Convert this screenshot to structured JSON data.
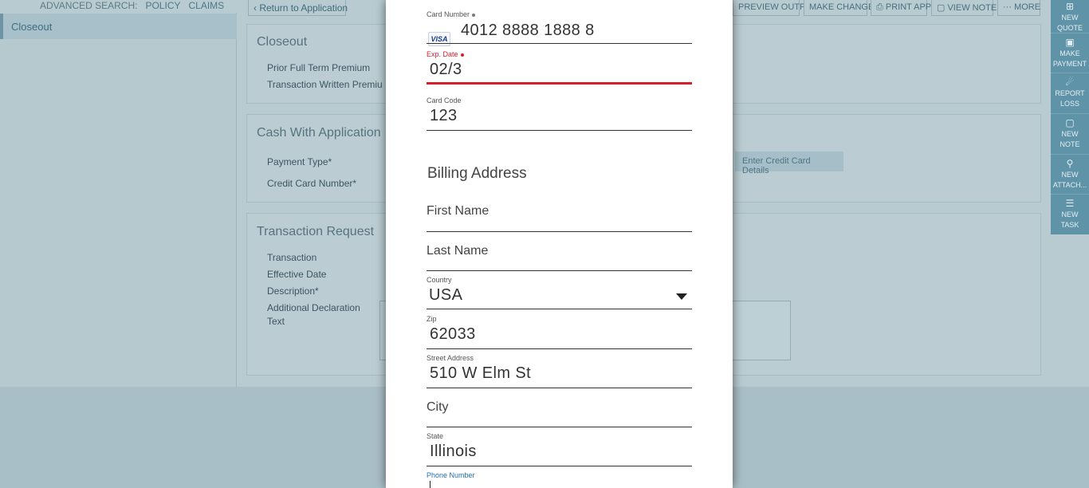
{
  "header": {
    "advanced_search_label": "ADVANCED SEARCH:",
    "policy_link": "POLICY",
    "claims_link": "CLAIMS"
  },
  "sidebar": {
    "items": [
      {
        "label": "Closeout"
      }
    ]
  },
  "toolbar": {
    "return_label": "Return to Application",
    "preview_output": "PREVIEW OUTPUT",
    "make_changes": "MAKE CHANGES",
    "print_app": "PRINT APP",
    "view_notes": "VIEW NOTES",
    "more": "MORE"
  },
  "closeout": {
    "title": "Closeout",
    "prior_full_term_premium": "Prior Full Term Premium",
    "transaction_written_premium": "Transaction Written Premiu"
  },
  "cash_with_application": {
    "title": "Cash With Application",
    "payment_type_label": "Payment Type*",
    "credit_card_number_label": "Credit Card Number*",
    "enter_cc_button": "Enter Credit Card Details"
  },
  "transaction_request": {
    "title": "Transaction Request",
    "transaction_label": "Transaction",
    "effective_date_label": "Effective Date",
    "description_label": "Description*",
    "additional_declaration_label_1": "Additional Declaration",
    "additional_declaration_label_2": "Text"
  },
  "right_actions": [
    {
      "line1": "NEW",
      "line2": "QUOTE",
      "icon": "new-quote-icon"
    },
    {
      "line1": "MAKE",
      "line2": "PAYMENT",
      "icon": "payment-icon"
    },
    {
      "line1": "REPORT",
      "line2": "LOSS",
      "icon": "report-loss-icon"
    },
    {
      "line1": "NEW",
      "line2": "NOTE",
      "icon": "note-icon"
    },
    {
      "line1": "NEW",
      "line2": "ATTACH...",
      "icon": "paperclip-icon"
    },
    {
      "line1": "NEW",
      "line2": "TASK",
      "icon": "task-icon"
    }
  ],
  "payment_form": {
    "card_number": {
      "label": "Card Number",
      "value": "4012 8888 1888 8",
      "brand": "VISA"
    },
    "exp_date": {
      "label": "Exp. Date",
      "value": "02/3",
      "error_color": "#d21f2b"
    },
    "card_code": {
      "label": "Card Code",
      "value": "123"
    },
    "billing_title": "Billing Address",
    "first_name": {
      "placeholder": "First Name"
    },
    "last_name": {
      "placeholder": "Last Name"
    },
    "country": {
      "label": "Country",
      "value": "USA"
    },
    "zip": {
      "label": "Zip",
      "value": "62033"
    },
    "street": {
      "label": "Street Address",
      "value": "510 W Elm St"
    },
    "city": {
      "placeholder": "City"
    },
    "state": {
      "label": "State",
      "value": "Illinois"
    },
    "phone": {
      "label": "Phone Number",
      "value": "",
      "focus_color": "#1f6fb2"
    }
  }
}
